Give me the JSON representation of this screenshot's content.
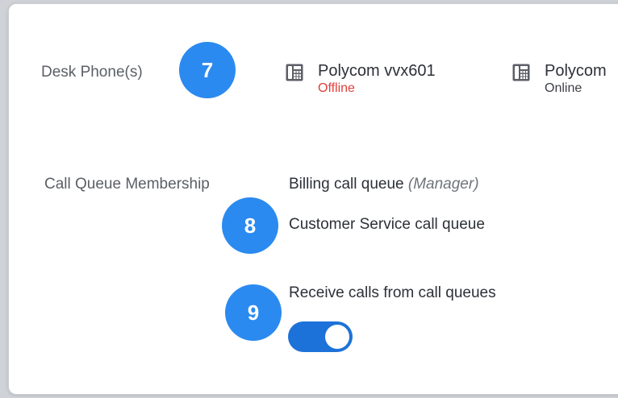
{
  "desk_phones": {
    "label": "Desk Phone(s)",
    "badge": "7",
    "devices": [
      {
        "name": "Polycom vvx601",
        "status": "Offline"
      },
      {
        "name": "Polycom",
        "status": "Online"
      }
    ]
  },
  "call_queue": {
    "label": "Call Queue Membership",
    "queues": [
      {
        "name": "Billing call queue",
        "role": "(Manager)"
      },
      {
        "name": "Customer Service call queue"
      }
    ],
    "badge": "8"
  },
  "receive_calls": {
    "label": "Receive calls from call queues",
    "badge": "9",
    "enabled": true
  },
  "colors": {
    "badge": "#2b8af0",
    "toggle_on": "#1d72d9",
    "offline": "#e0403b"
  }
}
